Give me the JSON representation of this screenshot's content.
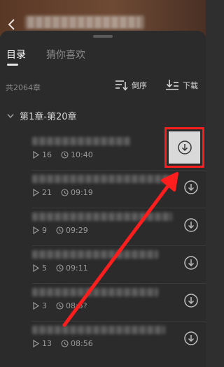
{
  "tabs": [
    {
      "label": "目录",
      "active": true
    },
    {
      "label": "猜你喜欢",
      "active": false
    }
  ],
  "toolbar": {
    "count_label": "共2064章",
    "reverse_label": "倒序",
    "download_label": "下载"
  },
  "section": {
    "label": "第1章-第20章"
  },
  "chapters": [
    {
      "plays": "16",
      "time": "10:40"
    },
    {
      "plays": "21",
      "time": "09:19"
    },
    {
      "plays": "9",
      "time": "09:29"
    },
    {
      "plays": "5",
      "time": "09:11"
    },
    {
      "plays": "3",
      "time": "08:5?"
    },
    {
      "plays": "13",
      "time": "08:56"
    }
  ],
  "colors": {
    "highlight": "#ff1e1e",
    "sheet": "#2b2b2b",
    "topbar": "#6e4a34"
  }
}
